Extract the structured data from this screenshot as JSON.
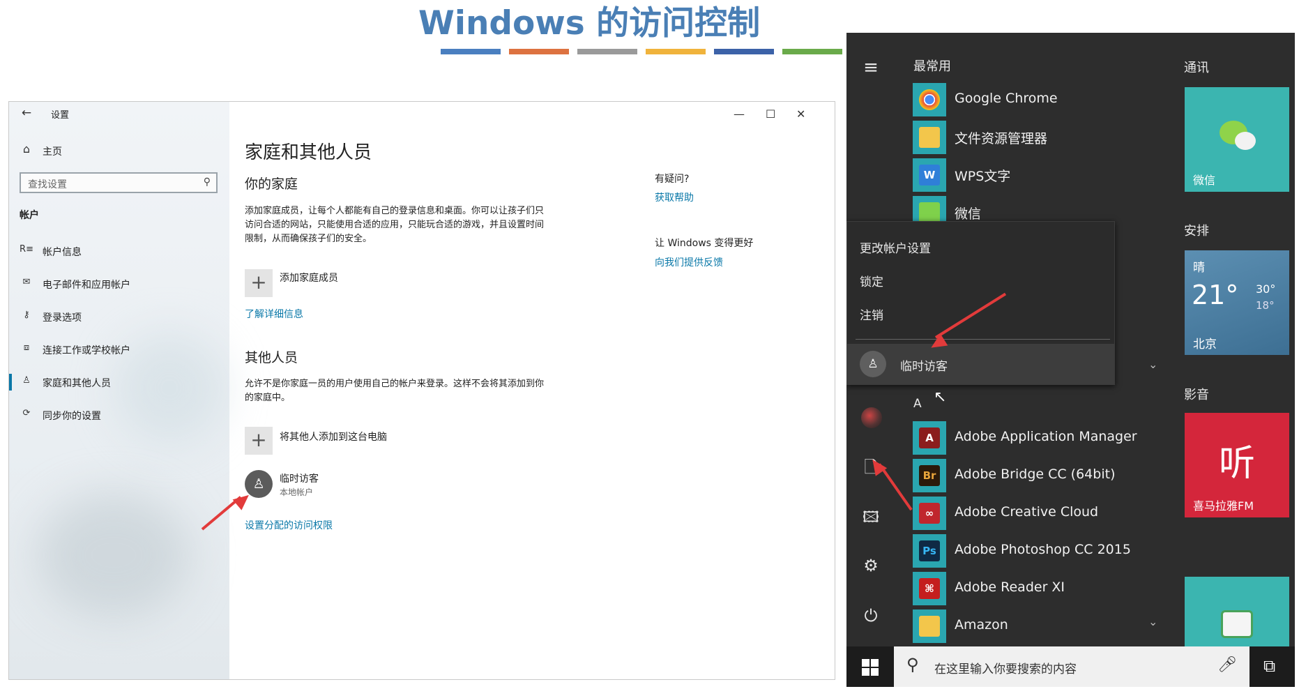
{
  "slide": {
    "title": "Windows 的访问控制",
    "bar_colors": [
      "#4a7fc0",
      "#dd7240",
      "#9a9a9a",
      "#f0b33c",
      "#3c62a8",
      "#6aaa4a"
    ]
  },
  "settings": {
    "window_title": "设置",
    "home_label": "主页",
    "search_placeholder": "查找设置",
    "section_label": "帐户",
    "nav": [
      {
        "icon": "account-info-icon",
        "label": "帐户信息"
      },
      {
        "icon": "mail-icon",
        "label": "电子邮件和应用帐户"
      },
      {
        "icon": "key-icon",
        "label": "登录选项"
      },
      {
        "icon": "briefcase-icon",
        "label": "连接工作或学校帐户"
      },
      {
        "icon": "people-icon",
        "label": "家庭和其他人员"
      },
      {
        "icon": "sync-icon",
        "label": "同步你的设置"
      }
    ],
    "page_title": "家庭和其他人员",
    "family_heading": "你的家庭",
    "family_desc": "添加家庭成员，让每个人都能有自己的登录信息和桌面。你可以让孩子们只访问合适的网站，只能使用合适的应用，只能玩合适的游戏，并且设置时间限制，从而确保孩子们的安全。",
    "add_family_label": "添加家庭成员",
    "learn_more_link": "了解详细信息",
    "others_heading": "其他人员",
    "others_desc": "允许不是你家庭一员的用户使用自己的帐户来登录。这样不会将其添加到你的家庭中。",
    "add_other_label": "将其他人添加到这台电脑",
    "user_name": "临时访客",
    "user_type": "本地帐户",
    "assigned_access_link": "设置分配的访问权限",
    "help_question": "有疑问?",
    "get_help_link": "获取帮助",
    "improve_heading": "让 Windows 变得更好",
    "feedback_link": "向我们提供反馈",
    "window_controls": {
      "minimize": "—",
      "maximize": "☐",
      "close": "✕"
    }
  },
  "start_menu": {
    "most_used_label": "最常用",
    "most_used": [
      {
        "label": "Google Chrome",
        "icon": "chrome-icon"
      },
      {
        "label": "文件资源管理器",
        "icon": "folder-icon"
      },
      {
        "label": "WPS文字",
        "icon": "wps-icon"
      },
      {
        "label": "微信",
        "icon": "wechat-icon"
      }
    ],
    "account_menu": [
      "更改帐户设置",
      "锁定",
      "注销"
    ],
    "account_user": "临时访客",
    "letter_a": "A",
    "apps": [
      {
        "label": "Adobe Application Manager",
        "icon": "adobe-am-icon",
        "glyph": "A"
      },
      {
        "label": "Adobe Bridge CC (64bit)",
        "icon": "adobe-bridge-icon",
        "glyph": "Br"
      },
      {
        "label": "Adobe Creative Cloud",
        "icon": "adobe-cc-icon",
        "glyph": "∞"
      },
      {
        "label": "Adobe Photoshop CC 2015",
        "icon": "photoshop-icon",
        "glyph": "Ps"
      },
      {
        "label": "Adobe Reader XI",
        "icon": "adobe-reader-icon",
        "glyph": "⌘"
      },
      {
        "label": "Amazon",
        "icon": "amazon-icon",
        "glyph": ""
      }
    ],
    "tiles": {
      "comm_header": "通讯",
      "wechat_tile": "微信",
      "schedule_header": "安排",
      "weather_cond": "晴",
      "weather_temp": "21°",
      "weather_high": "30°",
      "weather_low": "18°",
      "weather_city": "北京",
      "media_header": "影音",
      "media_tile": "喜马拉雅FM",
      "media_glyph": "听"
    },
    "taskbar_search_placeholder": "在这里输入你要搜索的内容"
  }
}
